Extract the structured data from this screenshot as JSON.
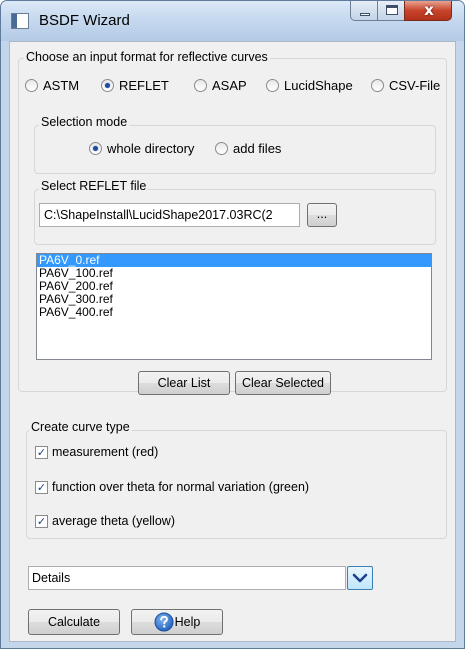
{
  "window": {
    "title": "BSDF Wizard",
    "close_glyph": "x"
  },
  "input_format": {
    "label": "Choose an input format for reflective curves",
    "options": [
      "ASTM",
      "REFLET",
      "ASAP",
      "LucidShape",
      "CSV-File"
    ],
    "selected": "REFLET"
  },
  "selection_mode": {
    "label": "Selection mode",
    "options": [
      "whole directory",
      "add files"
    ],
    "selected": "whole directory"
  },
  "file_select": {
    "label": "Select REFLET file",
    "path": "C:\\ShapeInstall\\LucidShape2017.03RC(2",
    "browse_label": "..."
  },
  "file_list": {
    "items": [
      "PA6V_0.ref",
      "PA6V_100.ref",
      "PA6V_200.ref",
      "PA6V_300.ref",
      "PA6V_400.ref"
    ],
    "selected_index": 0
  },
  "list_buttons": {
    "clear_list": "Clear List",
    "clear_selected": "Clear Selected"
  },
  "curve_type": {
    "label": "Create curve type",
    "options": [
      {
        "label": "measurement (red)",
        "checked": true
      },
      {
        "label": "function over theta for normal variation (green)",
        "checked": true
      },
      {
        "label": "average theta (yellow)",
        "checked": true
      }
    ],
    "check_glyph": "✓"
  },
  "details": {
    "value": "Details",
    "icon": "chevron-down-icon"
  },
  "footer": {
    "calculate": "Calculate",
    "help": "Help",
    "help_icon": "question-icon"
  },
  "colors": {
    "accent": "#3399ff",
    "titlebar": "#c4d6ea",
    "close": "#c7442b"
  }
}
